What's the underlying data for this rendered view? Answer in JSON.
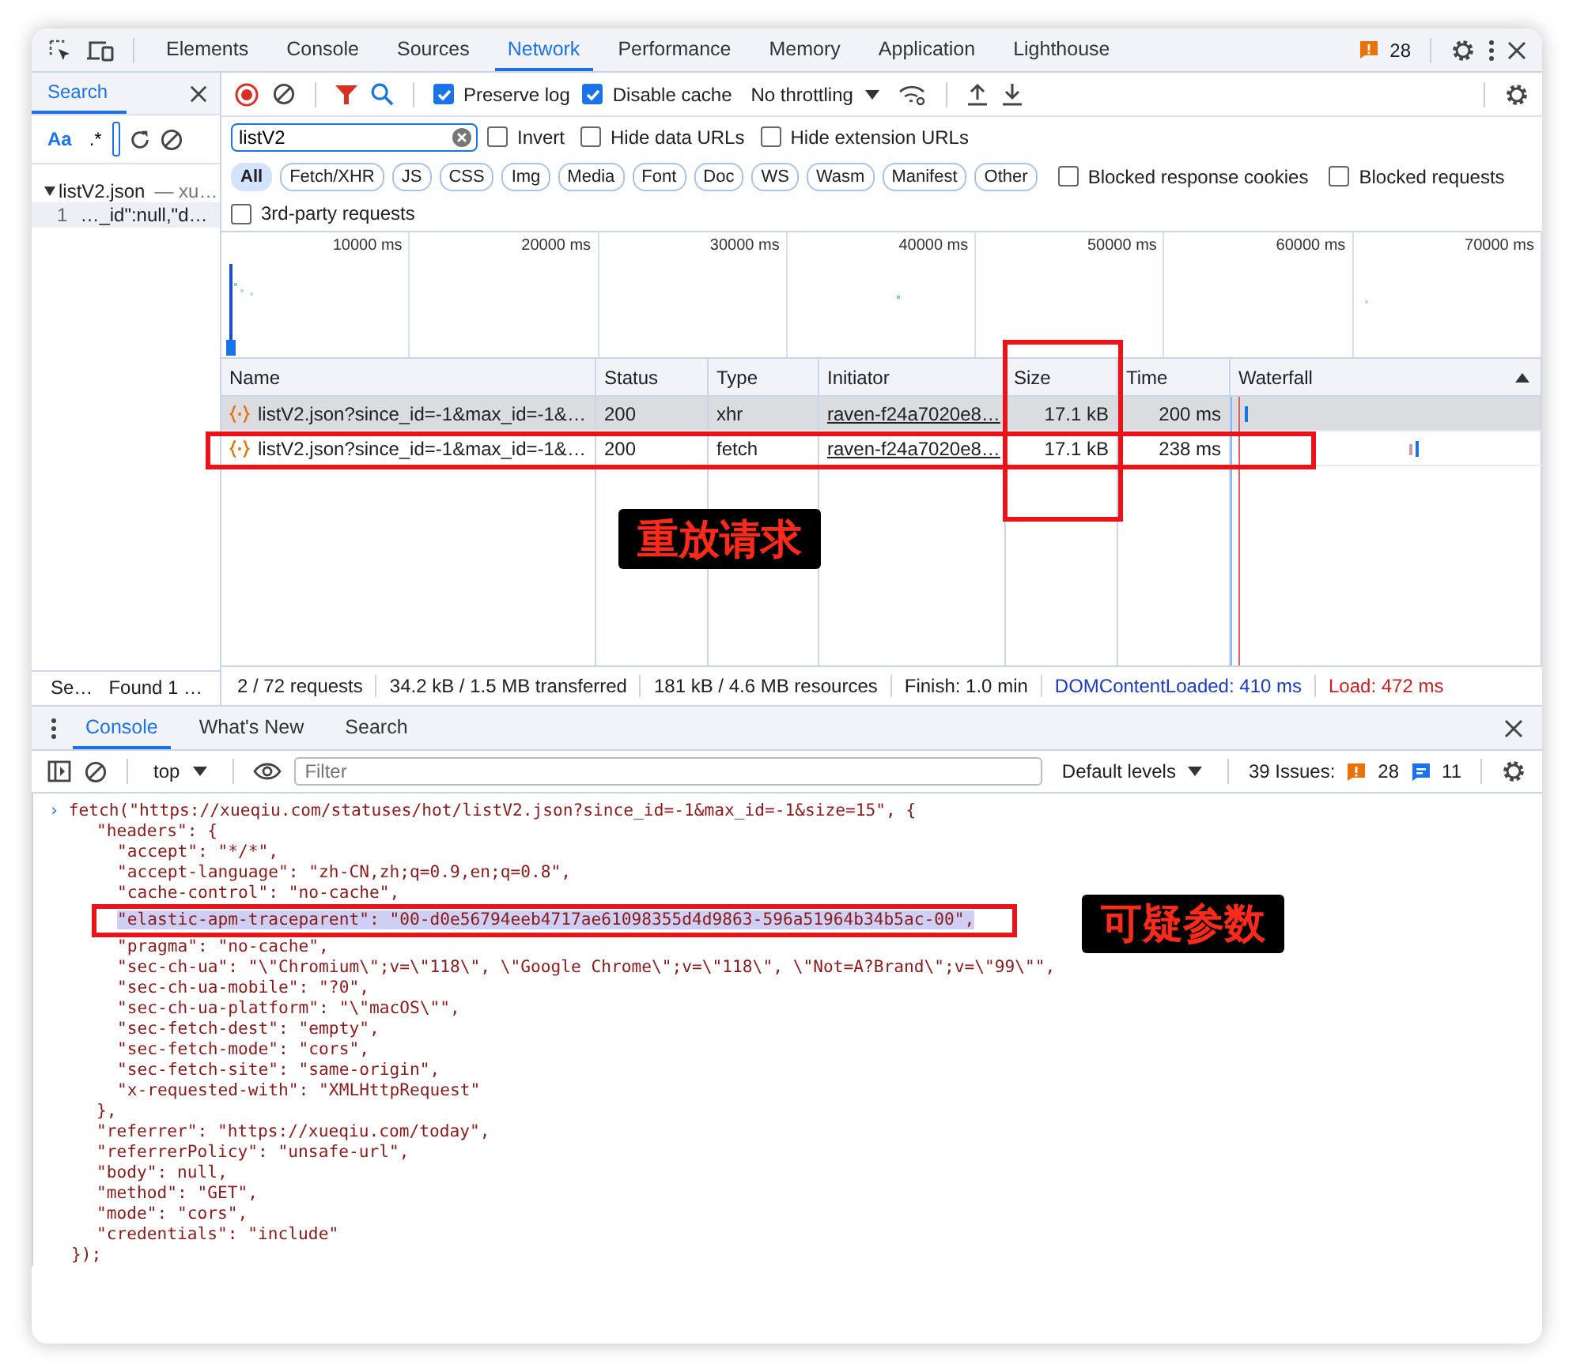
{
  "main_tabs": [
    {
      "label": "Elements",
      "selected": false
    },
    {
      "label": "Console",
      "selected": false
    },
    {
      "label": "Sources",
      "selected": false
    },
    {
      "label": "Network",
      "selected": true
    },
    {
      "label": "Performance",
      "selected": false
    },
    {
      "label": "Memory",
      "selected": false
    },
    {
      "label": "Application",
      "selected": false
    },
    {
      "label": "Lighthouse",
      "selected": false
    }
  ],
  "issues_count": "28",
  "search_panel": {
    "title": "Search",
    "match_case": "Aa",
    "regex": ".*",
    "result_file": "listV2.json",
    "result_host": "— xu…",
    "result_line_no": "1",
    "result_line": "…_id\":null,\"d…",
    "status": "Se…",
    "found": "Found 1 …"
  },
  "network_toolbar": {
    "preserve_log": {
      "label": "Preserve log",
      "checked": true
    },
    "disable_cache": {
      "label": "Disable cache",
      "checked": true
    },
    "throttling": "No throttling"
  },
  "filter": {
    "value": "listV2",
    "options": [
      {
        "label": "Invert",
        "checked": false
      },
      {
        "label": "Hide data URLs",
        "checked": false
      },
      {
        "label": "Hide extension URLs",
        "checked": false
      }
    ]
  },
  "type_filters": [
    {
      "label": "All",
      "selected": true
    },
    {
      "label": "Fetch/XHR",
      "selected": false
    },
    {
      "label": "JS",
      "selected": false
    },
    {
      "label": "CSS",
      "selected": false
    },
    {
      "label": "Img",
      "selected": false
    },
    {
      "label": "Media",
      "selected": false
    },
    {
      "label": "Font",
      "selected": false
    },
    {
      "label": "Doc",
      "selected": false
    },
    {
      "label": "WS",
      "selected": false
    },
    {
      "label": "Wasm",
      "selected": false
    },
    {
      "label": "Manifest",
      "selected": false
    },
    {
      "label": "Other",
      "selected": false
    }
  ],
  "blocked_filters": [
    {
      "label": "Blocked response cookies",
      "checked": false
    },
    {
      "label": "Blocked requests",
      "checked": false
    }
  ],
  "third_party": {
    "label": "3rd-party requests",
    "checked": false
  },
  "timeline_ticks": [
    "10000 ms",
    "20000 ms",
    "30000 ms",
    "40000 ms",
    "50000 ms",
    "60000 ms",
    "70000 ms"
  ],
  "table": {
    "columns": [
      "Name",
      "Status",
      "Type",
      "Initiator",
      "Size",
      "Time",
      "Waterfall"
    ],
    "rows": [
      {
        "name": "listV2.json?since_id=-1&max_id=-1&…",
        "status": "200",
        "type": "xhr",
        "initiator": "raven-f24a7020e8…",
        "size": "17.1 kB",
        "time": "200 ms",
        "selected": true
      },
      {
        "name": "listV2.json?since_id=-1&max_id=-1&…",
        "status": "200",
        "type": "fetch",
        "initiator": "raven-f24a7020e8…",
        "size": "17.1 kB",
        "time": "238 ms",
        "selected": false
      }
    ]
  },
  "status_bar": [
    {
      "text": "2 / 72 requests",
      "kind": "plain"
    },
    {
      "text": "34.2 kB / 1.5 MB transferred",
      "kind": "plain"
    },
    {
      "text": "181 kB / 4.6 MB resources",
      "kind": "plain"
    },
    {
      "text": "Finish: 1.0 min",
      "kind": "plain"
    },
    {
      "text": "DOMContentLoaded: 410 ms",
      "kind": "dom"
    },
    {
      "text": "Load: 472 ms",
      "kind": "load"
    }
  ],
  "drawer": {
    "tabs": [
      {
        "label": "Console",
        "selected": true
      },
      {
        "label": "What's New",
        "selected": false
      },
      {
        "label": "Search",
        "selected": false
      }
    ],
    "context": "top",
    "filter_placeholder": "Filter",
    "levels": "Default levels",
    "issues_label": "39 Issues:",
    "warnings": "28",
    "infos": "11"
  },
  "console": {
    "prompt": "›",
    "open": "fetch(\"https://xueqiu.com/statuses/hot/listV2.json?since_id=-1&max_id=-1&size=15\", {",
    "headers_open": "\"headers\": {",
    "headers": [
      {
        "text": "\"accept\": \"*/*\",",
        "highlighted": false
      },
      {
        "text": "\"accept-language\": \"zh-CN,zh;q=0.9,en;q=0.8\",",
        "highlighted": false
      },
      {
        "text": "\"cache-control\": \"no-cache\",",
        "highlighted": false
      },
      {
        "text": "\"elastic-apm-traceparent\": \"00-d0e56794eeb4717ae61098355d4d9863-596a51964b34b5ac-00\",",
        "highlighted": true
      },
      {
        "text": "\"pragma\": \"no-cache\",",
        "highlighted": false
      },
      {
        "text": "\"sec-ch-ua\": \"\\\"Chromium\\\";v=\\\"118\\\", \\\"Google Chrome\\\";v=\\\"118\\\", \\\"Not=A?Brand\\\";v=\\\"99\\\"\",",
        "highlighted": false
      },
      {
        "text": "\"sec-ch-ua-mobile\": \"?0\",",
        "highlighted": false
      },
      {
        "text": "\"sec-ch-ua-platform\": \"\\\"macOS\\\"\",",
        "highlighted": false
      },
      {
        "text": "\"sec-fetch-dest\": \"empty\",",
        "highlighted": false
      },
      {
        "text": "\"sec-fetch-mode\": \"cors\",",
        "highlighted": false
      },
      {
        "text": "\"sec-fetch-site\": \"same-origin\",",
        "highlighted": false
      },
      {
        "text": "\"x-requested-with\": \"XMLHttpRequest\"",
        "highlighted": false
      }
    ],
    "headers_close": "},",
    "options": [
      "\"referrer\": \"https://xueqiu.com/today\",",
      "\"referrerPolicy\": \"unsafe-url\",",
      "\"body\": null,",
      "\"method\": \"GET\",",
      "\"mode\": \"cors\",",
      "\"credentials\": \"include\""
    ],
    "close": "});"
  },
  "annotations": [
    {
      "kind": "box"
    },
    {
      "kind": "box"
    },
    {
      "kind": "label",
      "text": "重放请求"
    },
    {
      "kind": "box"
    },
    {
      "kind": "label",
      "text": "可疑参数"
    }
  ]
}
